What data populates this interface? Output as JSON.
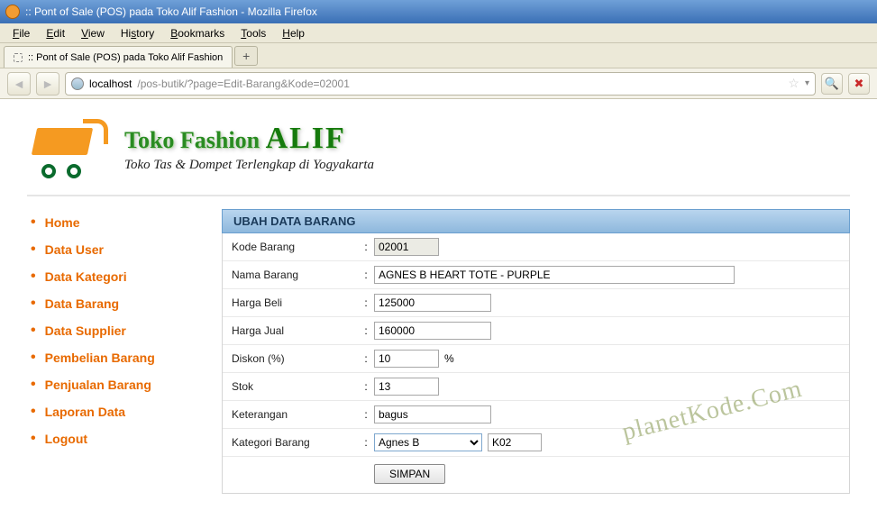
{
  "window": {
    "title": ":: Pont of Sale (POS) pada Toko Alif Fashion - Mozilla Firefox"
  },
  "menu": {
    "file": "File",
    "edit": "Edit",
    "view": "View",
    "history": "History",
    "bookmarks": "Bookmarks",
    "tools": "Tools",
    "help": "Help"
  },
  "tab": {
    "title": ":: Pont of Sale (POS) pada Toko Alif Fashion"
  },
  "url": {
    "host": "localhost",
    "path": "/pos-butik/?page=Edit-Barang&Kode=02001"
  },
  "brand": {
    "line1a": "Toko Fashion ",
    "line1b": "ALIF",
    "line2": "Toko Tas & Dompet Terlengkap di Yogyakarta"
  },
  "sidebar": {
    "items": [
      {
        "label": "Home"
      },
      {
        "label": "Data User"
      },
      {
        "label": "Data Kategori"
      },
      {
        "label": "Data Barang"
      },
      {
        "label": "Data Supplier"
      },
      {
        "label": "Pembelian Barang"
      },
      {
        "label": "Penjualan Barang"
      },
      {
        "label": "Laporan Data"
      },
      {
        "label": "Logout"
      }
    ]
  },
  "panel": {
    "title": "UBAH DATA BARANG"
  },
  "form": {
    "kode": {
      "label": "Kode Barang",
      "value": "02001"
    },
    "nama": {
      "label": "Nama Barang",
      "value": "AGNES B HEART TOTE - PURPLE"
    },
    "beli": {
      "label": "Harga Beli",
      "value": "125000"
    },
    "jual": {
      "label": "Harga Jual",
      "value": "160000"
    },
    "diskon": {
      "label": "Diskon (%)",
      "value": "10",
      "suffix": "%"
    },
    "stok": {
      "label": "Stok",
      "value": "13"
    },
    "ket": {
      "label": "Keterangan",
      "value": "bagus"
    },
    "kat": {
      "label": "Kategori Barang",
      "selected": "Agnes B",
      "code": "K02"
    },
    "submit": "SIMPAN"
  },
  "watermark": "planetKode.Com"
}
